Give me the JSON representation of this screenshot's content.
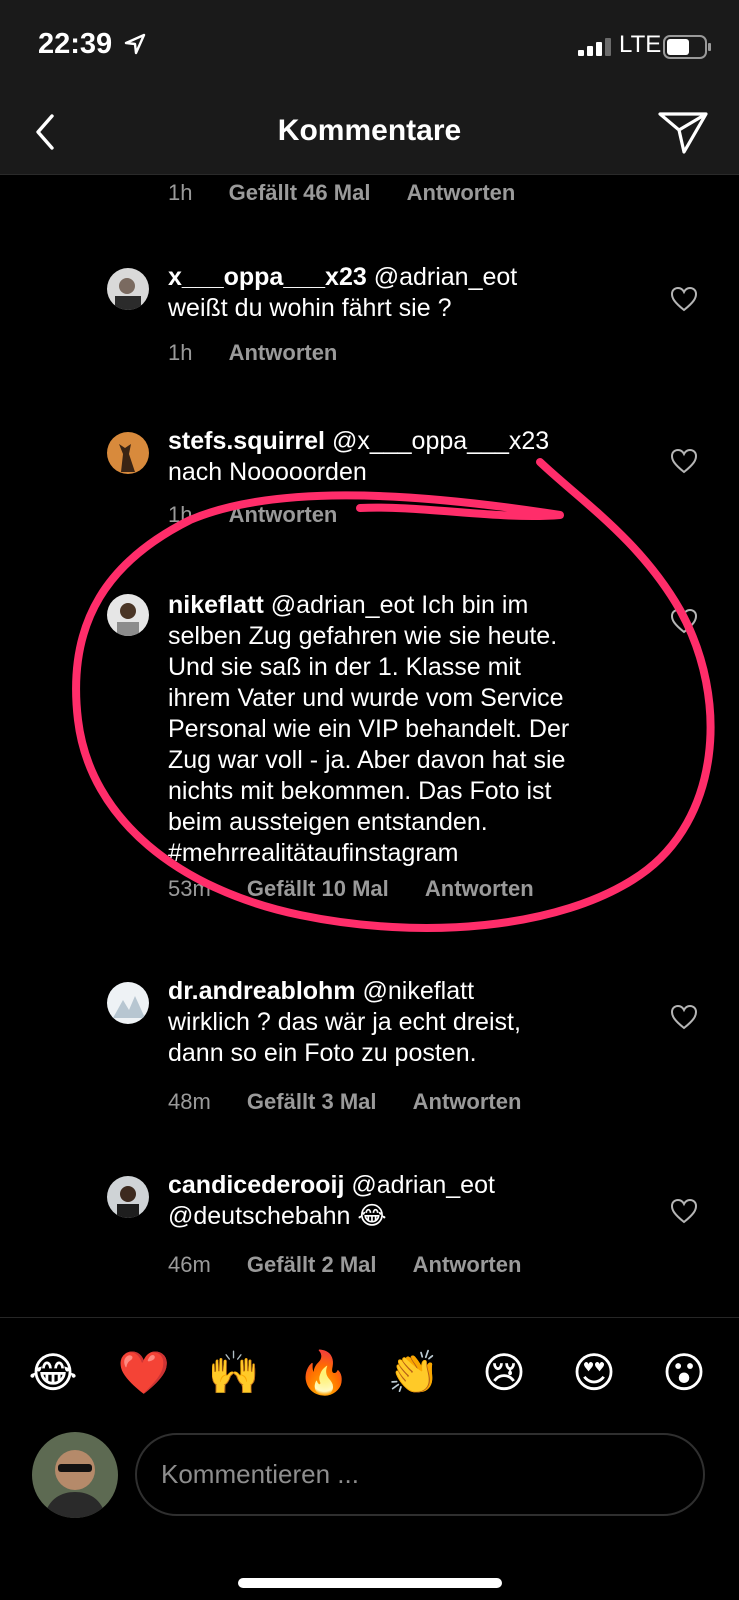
{
  "status_bar": {
    "time": "22:39",
    "network": "LTE"
  },
  "header": {
    "title": "Kommentare"
  },
  "top_meta": {
    "time": "1h",
    "likes": "Gefällt 46 Mal",
    "reply": "Antworten"
  },
  "comments": [
    {
      "username": "x___oppa___x23",
      "lines": [
        " @adrian_eot",
        "weißt du wohin fährt sie ?"
      ],
      "time": "1h",
      "likes": "",
      "reply": "Antworten"
    },
    {
      "username": "stefs.squirrel",
      "lines": [
        " @x___oppa___x23",
        "nach Nooooorden"
      ],
      "time": "1h",
      "likes": "",
      "reply": "Antworten"
    },
    {
      "username": "nikeflatt",
      "lines": [
        " @adrian_eot Ich bin im",
        "selben Zug gefahren wie sie heute.",
        "Und sie saß in der 1. Klasse mit",
        "ihrem Vater und wurde vom Service",
        "Personal wie ein VIP behandelt. Der",
        "Zug war voll - ja. Aber davon hat sie",
        "nichts mit bekommen. Das Foto ist",
        "beim aussteigen entstanden.",
        "#mehrrealitätaufinstagram"
      ],
      "time": "53m",
      "likes": "Gefällt 10 Mal",
      "reply": "Antworten"
    },
    {
      "username": "dr.andreablohm",
      "lines": [
        " @nikeflatt",
        "wirklich ? das wär ja echt dreist,",
        "dann so ein Foto zu posten."
      ],
      "time": "48m",
      "likes": "Gefällt 3 Mal",
      "reply": "Antworten"
    },
    {
      "username": "candicederooij",
      "lines": [
        " @adrian_eot",
        "@deutschebahn 😂"
      ],
      "time": "46m",
      "likes": "Gefällt 2 Mal",
      "reply": "Antworten"
    }
  ],
  "emoji_bar": [
    "😂",
    "❤️",
    "🙌",
    "🔥",
    "👏",
    "😢",
    "😍",
    "😮"
  ],
  "composer": {
    "placeholder": "Kommentieren ..."
  },
  "colors": {
    "annotation": "#ff2d6a",
    "background": "#000000",
    "header": "#1a1a1a"
  }
}
